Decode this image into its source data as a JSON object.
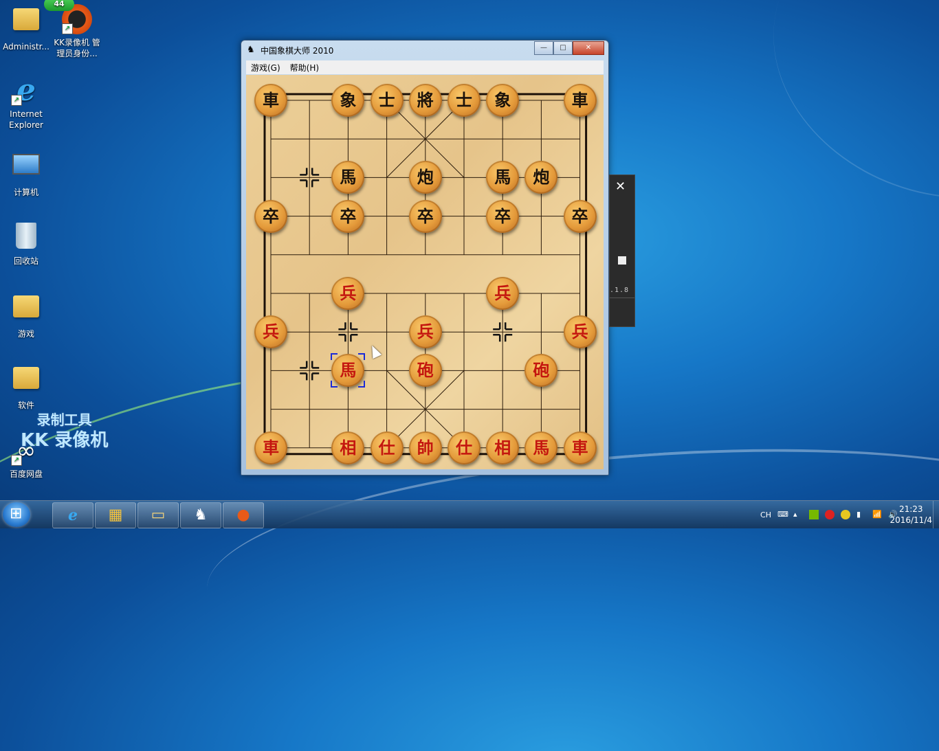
{
  "desktop": {
    "icons": [
      {
        "label": "Administr...",
        "icon": "user-folder-icon"
      },
      {
        "label": "KK录像机 管理员身份...",
        "icon": "kk-recorder-icon",
        "badge": "44"
      },
      {
        "label": "Internet Explorer",
        "icon": "internet-explorer-icon"
      },
      {
        "label": "计算机",
        "icon": "computer-icon"
      },
      {
        "label": "回收站",
        "icon": "recycle-bin-icon"
      },
      {
        "label": "游戏",
        "icon": "folder-icon"
      },
      {
        "label": "软件",
        "icon": "folder-icon"
      },
      {
        "label": "百度网盘",
        "icon": "baidu-netdisk-icon"
      }
    ],
    "watermark": {
      "line1": "录制工具",
      "line2": "KK 录像机"
    }
  },
  "window": {
    "title": "中国象棋大师 2010",
    "menu": [
      "游戏(G)",
      "帮助(H)"
    ],
    "buttons": {
      "minimize": "—",
      "maximize": "□",
      "close": "✕"
    }
  },
  "board": {
    "black_pieces": [
      {
        "char": "車",
        "col": 0,
        "row": 0
      },
      {
        "char": "象",
        "col": 2,
        "row": 0
      },
      {
        "char": "士",
        "col": 3,
        "row": 0
      },
      {
        "char": "將",
        "col": 4,
        "row": 0
      },
      {
        "char": "士",
        "col": 5,
        "row": 0
      },
      {
        "char": "象",
        "col": 6,
        "row": 0
      },
      {
        "char": "車",
        "col": 8,
        "row": 0
      },
      {
        "char": "馬",
        "col": 2,
        "row": 2
      },
      {
        "char": "炮",
        "col": 4,
        "row": 2
      },
      {
        "char": "馬",
        "col": 6,
        "row": 2
      },
      {
        "char": "炮",
        "col": 7,
        "row": 2
      },
      {
        "char": "卒",
        "col": 0,
        "row": 3
      },
      {
        "char": "卒",
        "col": 2,
        "row": 3
      },
      {
        "char": "卒",
        "col": 4,
        "row": 3
      },
      {
        "char": "卒",
        "col": 6,
        "row": 3
      },
      {
        "char": "卒",
        "col": 8,
        "row": 3
      }
    ],
    "red_pieces": [
      {
        "char": "兵",
        "col": 2,
        "row": 5
      },
      {
        "char": "兵",
        "col": 6,
        "row": 5
      },
      {
        "char": "兵",
        "col": 0,
        "row": 6
      },
      {
        "char": "兵",
        "col": 4,
        "row": 6
      },
      {
        "char": "兵",
        "col": 8,
        "row": 6
      },
      {
        "char": "馬",
        "col": 2,
        "row": 7,
        "selected": true
      },
      {
        "char": "砲",
        "col": 4,
        "row": 7
      },
      {
        "char": "砲",
        "col": 7,
        "row": 7
      },
      {
        "char": "車",
        "col": 0,
        "row": 9
      },
      {
        "char": "相",
        "col": 2,
        "row": 9
      },
      {
        "char": "仕",
        "col": 3,
        "row": 9
      },
      {
        "char": "帥",
        "col": 4,
        "row": 9
      },
      {
        "char": "仕",
        "col": 5,
        "row": 9
      },
      {
        "char": "相",
        "col": 6,
        "row": 9
      },
      {
        "char": "馬",
        "col": 7,
        "row": 9
      },
      {
        "char": "車",
        "col": 8,
        "row": 9
      }
    ],
    "markers": [
      {
        "col": 1,
        "row": 2
      },
      {
        "col": 2,
        "row": 6
      },
      {
        "col": 6,
        "row": 6
      },
      {
        "col": 1,
        "row": 7
      }
    ]
  },
  "side_panel": {
    "close": "✕",
    "version": ".1.8"
  },
  "taskbar": {
    "apps": [
      "internet-explorer-icon",
      "windows-store-icon",
      "file-explorer-icon",
      "chess-app-icon",
      "kk-recorder-icon"
    ],
    "tray_lang": "CH",
    "time": "21:23",
    "date": "2016/11/4"
  }
}
